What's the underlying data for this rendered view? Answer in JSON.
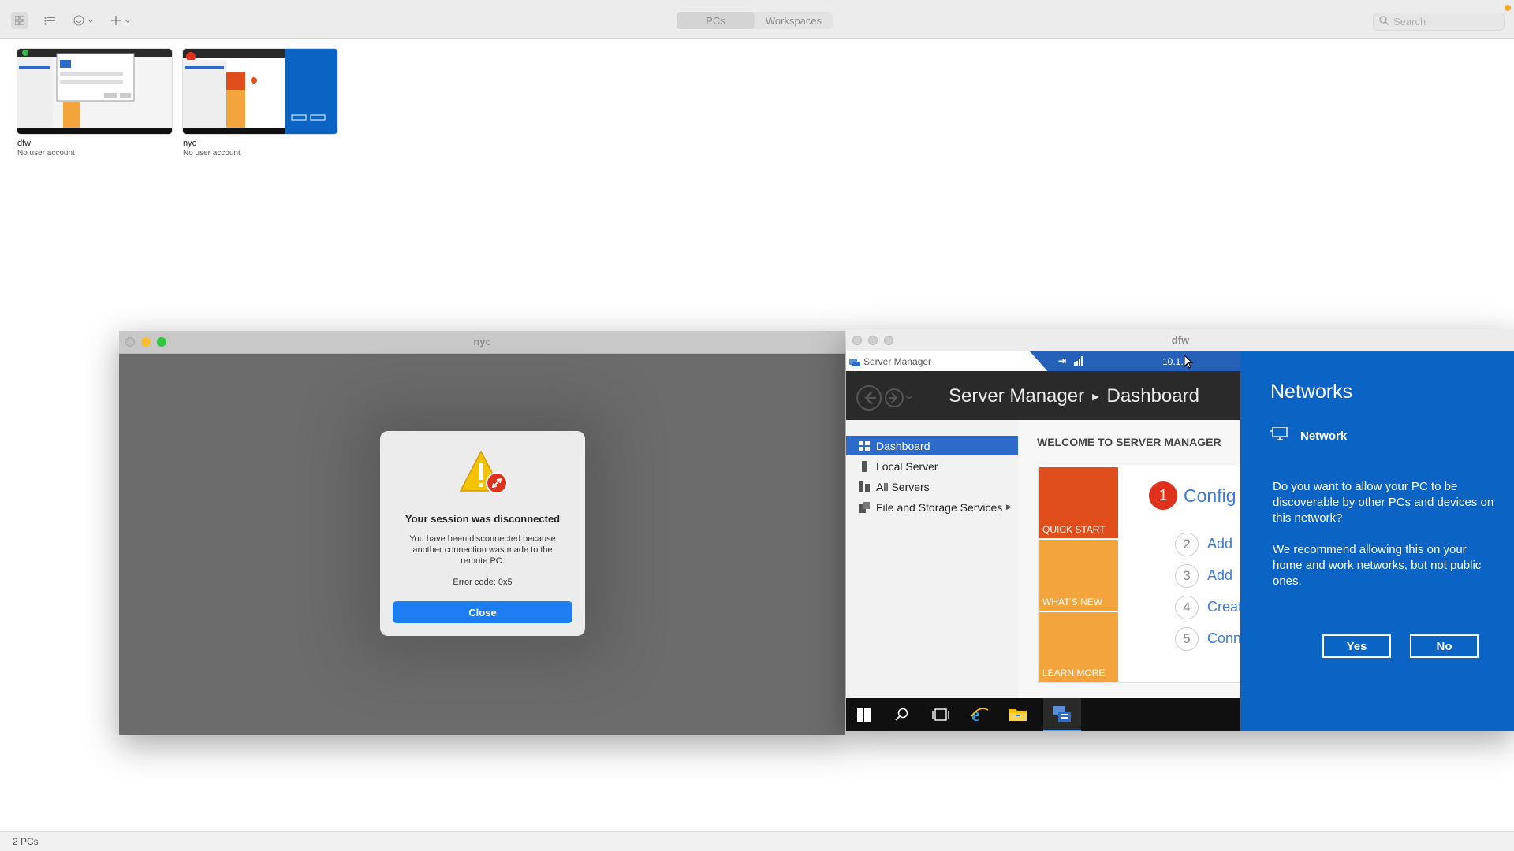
{
  "toolbar": {
    "grid_icon": "grid-view-icon",
    "list_icon": "list-view-icon",
    "smile_icon": "smiley-menu-icon",
    "add_icon": "plus-menu-icon",
    "segments": [
      "PCs",
      "Workspaces"
    ],
    "active_segment": "PCs",
    "search_placeholder": "Search"
  },
  "pcs": [
    {
      "name": "dfw",
      "subtitle": "No user account"
    },
    {
      "name": "nyc",
      "subtitle": "No user account"
    }
  ],
  "status_bar": {
    "text": "2 PCs"
  },
  "nyc_window": {
    "title": "nyc",
    "dialog": {
      "title": "Your session was disconnected",
      "message": "You have been disconnected because another connection was made to the remote PC.",
      "error": "Error code: 0x5",
      "close_label": "Close"
    }
  },
  "dfw_window": {
    "title": "dfw",
    "rdp_bar": {
      "address": "10.1."
    },
    "app_title": "Server Manager",
    "breadcrumb": {
      "root": "Server Manager",
      "current": "Dashboard"
    },
    "nav": [
      "Dashboard",
      "Local Server",
      "All Servers",
      "File and Storage Services"
    ],
    "welcome": "WELCOME TO SERVER MANAGER",
    "tiles": [
      "QUICK START",
      "WHAT'S NEW",
      "LEARN MORE"
    ],
    "steps": [
      {
        "num": "1",
        "label": "Config"
      },
      {
        "num": "2",
        "label": "Add"
      },
      {
        "num": "3",
        "label": "Add"
      },
      {
        "num": "4",
        "label": "Creat"
      },
      {
        "num": "5",
        "label": "Conn"
      }
    ],
    "networks": {
      "heading": "Networks",
      "network_name": "Network",
      "question": "Do you want to allow your PC to be discoverable by other PCs and devices on this network?",
      "recommendation": "We recommend allowing this on your home and work networks, but not public ones.",
      "yes_label": "Yes",
      "no_label": "No"
    }
  },
  "colors": {
    "accent": "#1d7df2",
    "win_blue": "#0b63c3",
    "sm_orange_dark": "#e04e1c",
    "sm_orange": "#f3a43c",
    "notification": "#f5a623"
  }
}
